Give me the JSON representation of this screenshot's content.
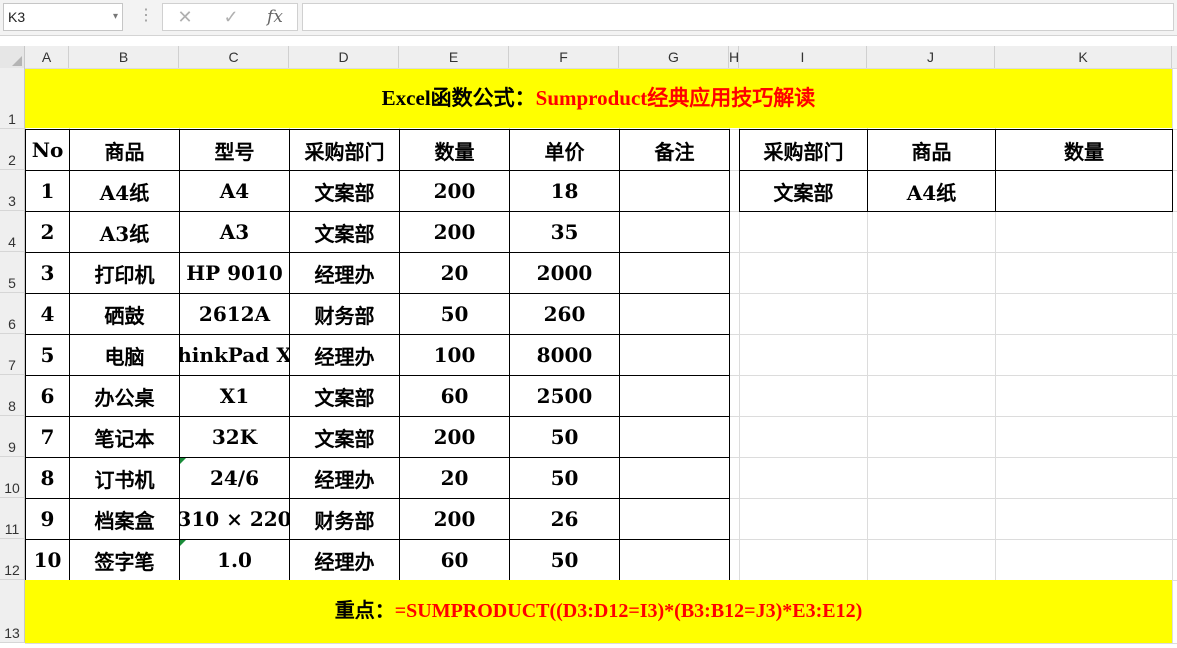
{
  "namebox": {
    "value": "K3",
    "dropdown_glyph": "▾"
  },
  "formula_bar": {
    "cancel_glyph": "✕",
    "enter_glyph": "✓",
    "fx_glyph": "fx",
    "value": ""
  },
  "columns": [
    "A",
    "B",
    "C",
    "D",
    "E",
    "F",
    "G",
    "H",
    "I",
    "J",
    "K"
  ],
  "rows": [
    "1",
    "2",
    "3",
    "4",
    "5",
    "6",
    "7",
    "8",
    "9",
    "10",
    "11",
    "12",
    "13"
  ],
  "title": {
    "black_part": "Excel函数公式：",
    "red_part": "Sumproduct经典应用技巧解读"
  },
  "table_headers": [
    "No",
    "商品",
    "型号",
    "采购部门",
    "数量",
    "单价",
    "备注"
  ],
  "table_rows": [
    [
      "1",
      "A4纸",
      "A4",
      "文案部",
      "200",
      "18",
      ""
    ],
    [
      "2",
      "A3纸",
      "A3",
      "文案部",
      "200",
      "35",
      ""
    ],
    [
      "3",
      "打印机",
      "HP  9010",
      "经理办",
      "20",
      "2000",
      ""
    ],
    [
      "4",
      "硒鼓",
      "2612A",
      "财务部",
      "50",
      "260",
      ""
    ],
    [
      "5",
      "电脑",
      "hinkPad  X",
      "经理办",
      "100",
      "8000",
      ""
    ],
    [
      "6",
      "办公桌",
      "X1",
      "文案部",
      "60",
      "2500",
      ""
    ],
    [
      "7",
      "笔记本",
      "32K",
      "文案部",
      "200",
      "50",
      ""
    ],
    [
      "8",
      "订书机",
      "24/6",
      "经理办",
      "20",
      "50",
      ""
    ],
    [
      "9",
      "档案盒",
      "310 × 220",
      "财务部",
      "200",
      "26",
      ""
    ],
    [
      "10",
      "签字笔",
      "1.0",
      "经理办",
      "60",
      "50",
      ""
    ]
  ],
  "lookup_headers": [
    "采购部门",
    "商品",
    "数量"
  ],
  "lookup_values": [
    "文案部",
    "A4纸",
    ""
  ],
  "footer": {
    "black_part": "重点：",
    "red_part": "=SUMPRODUCT((D3:D12=I3)*(B3:B12=J3)*E3:E12)"
  },
  "colors": {
    "banner": "#ffff00",
    "accent_red": "#ff0000",
    "error_triangle": "#1a8c3a"
  }
}
